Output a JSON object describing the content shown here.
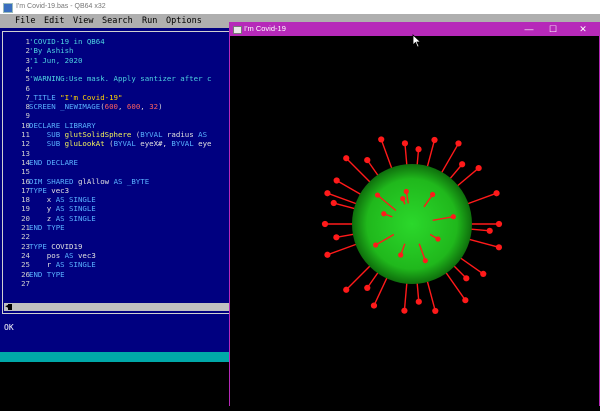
{
  "qb_window": {
    "title": "I'm Covid-19.bas - QB64 x32",
    "menu": [
      "File",
      "Edit",
      "View",
      "Search",
      "Run",
      "Options"
    ],
    "status_text": "OK"
  },
  "editor": {
    "line_numbers": [
      "1",
      "2",
      "3",
      "4",
      "5",
      "6",
      "7",
      "8",
      "9",
      "10",
      "11",
      "12",
      "13",
      "14",
      "15",
      "16",
      "17",
      "18",
      "19",
      "20",
      "21",
      "22",
      "23",
      "24",
      "25",
      "26",
      "27"
    ],
    "lines": [
      [
        {
          "t": "'COVID-19 in QB64",
          "c": "cm"
        }
      ],
      [
        {
          "t": "'By Ashish",
          "c": "cm"
        }
      ],
      [
        {
          "t": "'1 Jun, 2020",
          "c": "cm"
        }
      ],
      [
        {
          "t": "'",
          "c": "cm"
        }
      ],
      [
        {
          "t": "'WARNING:Use mask. Apply santizer after c",
          "c": "cm"
        }
      ],
      [],
      [
        {
          "t": "_TITLE ",
          "c": "kw"
        },
        {
          "t": "\"I'm Covid-19\"",
          "c": "st"
        }
      ],
      [
        {
          "t": "SCREEN ",
          "c": "kw"
        },
        {
          "t": "_NEWIMAGE",
          "c": "kw"
        },
        {
          "t": "(",
          "c": "sym"
        },
        {
          "t": "600",
          "c": "nu"
        },
        {
          "t": ", ",
          "c": "sym"
        },
        {
          "t": "600",
          "c": "nu"
        },
        {
          "t": ", ",
          "c": "sym"
        },
        {
          "t": "32",
          "c": "nu"
        },
        {
          "t": ")",
          "c": "sym"
        }
      ],
      [],
      [
        {
          "t": "DECLARE LIBRARY",
          "c": "kw"
        }
      ],
      [
        {
          "t": "    SUB ",
          "c": "kw"
        },
        {
          "t": "glutSolidSphere",
          "c": "fn"
        },
        {
          "t": " (",
          "c": "sym"
        },
        {
          "t": "BYVAL",
          "c": "kw"
        },
        {
          "t": " radius ",
          "c": "tp"
        },
        {
          "t": "AS",
          "c": "kw"
        }
      ],
      [
        {
          "t": "    SUB ",
          "c": "kw"
        },
        {
          "t": "gluLookAt",
          "c": "fn"
        },
        {
          "t": " (",
          "c": "sym"
        },
        {
          "t": "BYVAL",
          "c": "kw"
        },
        {
          "t": " eyeX#, ",
          "c": "tp"
        },
        {
          "t": "BYVAL",
          "c": "kw"
        },
        {
          "t": " eye",
          "c": "tp"
        }
      ],
      [],
      [
        {
          "t": "END DECLARE",
          "c": "kw"
        }
      ],
      [],
      [
        {
          "t": "DIM SHARED ",
          "c": "kw"
        },
        {
          "t": "glAllow ",
          "c": "tp"
        },
        {
          "t": "AS _BYTE",
          "c": "kw"
        }
      ],
      [
        {
          "t": "TYPE ",
          "c": "kw"
        },
        {
          "t": "vec3",
          "c": "tp"
        }
      ],
      [
        {
          "t": "    x ",
          "c": "tp"
        },
        {
          "t": "AS SINGLE",
          "c": "kw"
        }
      ],
      [
        {
          "t": "    y ",
          "c": "tp"
        },
        {
          "t": "AS SINGLE",
          "c": "kw"
        }
      ],
      [
        {
          "t": "    z ",
          "c": "tp"
        },
        {
          "t": "AS SINGLE",
          "c": "kw"
        }
      ],
      [
        {
          "t": "END TYPE",
          "c": "kw"
        }
      ],
      [],
      [
        {
          "t": "TYPE ",
          "c": "kw"
        },
        {
          "t": "COVID19",
          "c": "tp"
        }
      ],
      [
        {
          "t": "    pos ",
          "c": "tp"
        },
        {
          "t": "AS ",
          "c": "kw"
        },
        {
          "t": "vec3",
          "c": "tp"
        }
      ],
      [
        {
          "t": "    r ",
          "c": "tp"
        },
        {
          "t": "AS SINGLE",
          "c": "kw"
        }
      ],
      [
        {
          "t": "END TYPE",
          "c": "kw"
        }
      ],
      []
    ]
  },
  "output_window": {
    "title": "I'm Covid-19",
    "minimize_glyph": "—",
    "maximize_glyph": "☐",
    "close_glyph": "✕"
  },
  "colors": {
    "qb_background": "#000080",
    "window_accent": "#b629b9",
    "virus_body": "#22c81e",
    "spike": "#ff1a1a",
    "status_bar": "#00a8a8"
  },
  "icons": {
    "qb_app": "qb64-icon",
    "output_app": "window-icon",
    "cursor": "mouse-pointer"
  }
}
